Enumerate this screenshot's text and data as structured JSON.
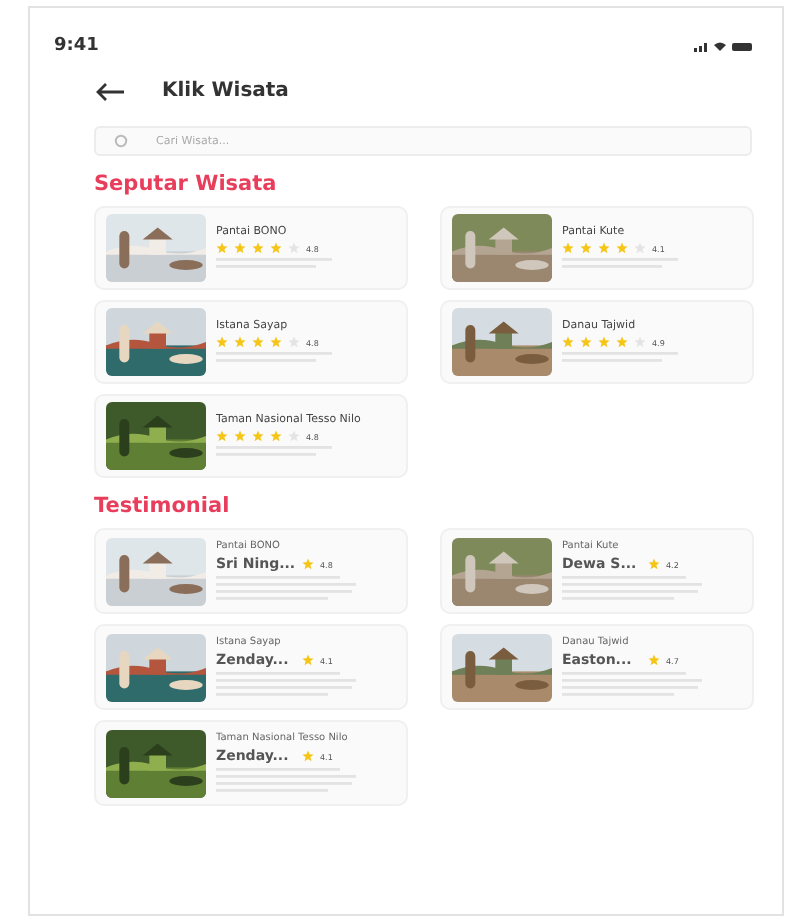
{
  "status_bar": {
    "time": "9:41"
  },
  "header": {
    "title": "Klik Wisata"
  },
  "search": {
    "placeholder": "Cari Wisata..."
  },
  "sections": [
    {
      "title": "Seputar Wisata",
      "kind": "place",
      "cards": [
        {
          "name": "Pantai BONO",
          "stars": 4,
          "rating": "4.8"
        },
        {
          "name": "Pantai Kute",
          "stars": 4,
          "rating": "4.1"
        },
        {
          "name": "Istana Sayap",
          "stars": 4,
          "rating": "4.8"
        },
        {
          "name": "Danau Tajwid",
          "stars": 4,
          "rating": "4.9"
        },
        {
          "name": "Taman Nasional Tesso Nilo",
          "stars": 4,
          "rating": "4.8"
        }
      ]
    },
    {
      "title": "Testimonial",
      "kind": "review",
      "cards": [
        {
          "place": "Pantai BONO",
          "name": "Sri Ning...",
          "rating": "4.8"
        },
        {
          "place": "Pantai Kute",
          "name": "Dewa S...",
          "rating": "4.2"
        },
        {
          "place": "Istana Sayap",
          "name": "Zenday...",
          "rating": "4.1"
        },
        {
          "place": "Danau Tajwid",
          "name": "Easton...",
          "rating": "4.7"
        },
        {
          "place": "Taman Nasional Tesso Nilo",
          "name": "Zenday...",
          "rating": "4.1"
        }
      ]
    }
  ]
}
